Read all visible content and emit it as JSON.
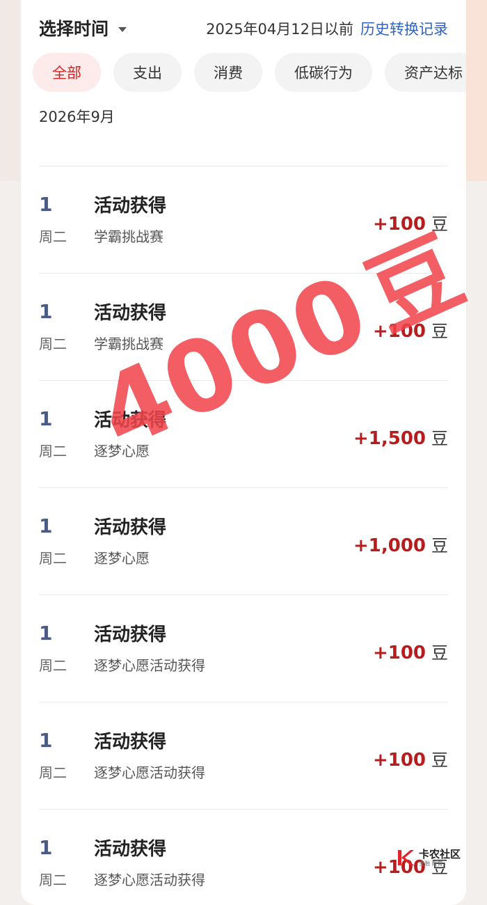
{
  "header": {
    "time_select_label": "选择时间",
    "date_before": "2025年04月12日以前",
    "history_link": "历史转换记录"
  },
  "tabs": [
    {
      "label": "全部",
      "active": true
    },
    {
      "label": "支出",
      "active": false
    },
    {
      "label": "消费",
      "active": false
    },
    {
      "label": "低碳行为",
      "active": false
    },
    {
      "label": "资产达标",
      "active": false
    }
  ],
  "month_label": "2026年9月",
  "items": [
    {
      "day": "1",
      "weekday": "周二",
      "title": "活动获得",
      "subtitle": "学霸挑战赛",
      "amount": "+100",
      "unit": "豆"
    },
    {
      "day": "1",
      "weekday": "周二",
      "title": "活动获得",
      "subtitle": "学霸挑战赛",
      "amount": "+100",
      "unit": "豆"
    },
    {
      "day": "1",
      "weekday": "周二",
      "title": "活动获得",
      "subtitle": "逐梦心愿",
      "amount": "+1,500",
      "unit": "豆"
    },
    {
      "day": "1",
      "weekday": "周二",
      "title": "活动获得",
      "subtitle": "逐梦心愿",
      "amount": "+1,000",
      "unit": "豆"
    },
    {
      "day": "1",
      "weekday": "周二",
      "title": "活动获得",
      "subtitle": "逐梦心愿活动获得",
      "amount": "+100",
      "unit": "豆"
    },
    {
      "day": "1",
      "weekday": "周二",
      "title": "活动获得",
      "subtitle": "逐梦心愿活动获得",
      "amount": "+100",
      "unit": "豆"
    },
    {
      "day": "1",
      "weekday": "周二",
      "title": "活动获得",
      "subtitle": "逐梦心愿活动获得",
      "amount": "+100",
      "unit": "豆"
    }
  ],
  "stamp": {
    "number": "4000",
    "unit": "豆"
  },
  "watermark": {
    "main": "卡农社区",
    "sub": "金融 教育"
  },
  "colors": {
    "accent_red": "#d6201f",
    "amount_red": "#b81c1c",
    "link_blue": "#2f63c6",
    "stamp_red": "#f0444a"
  }
}
